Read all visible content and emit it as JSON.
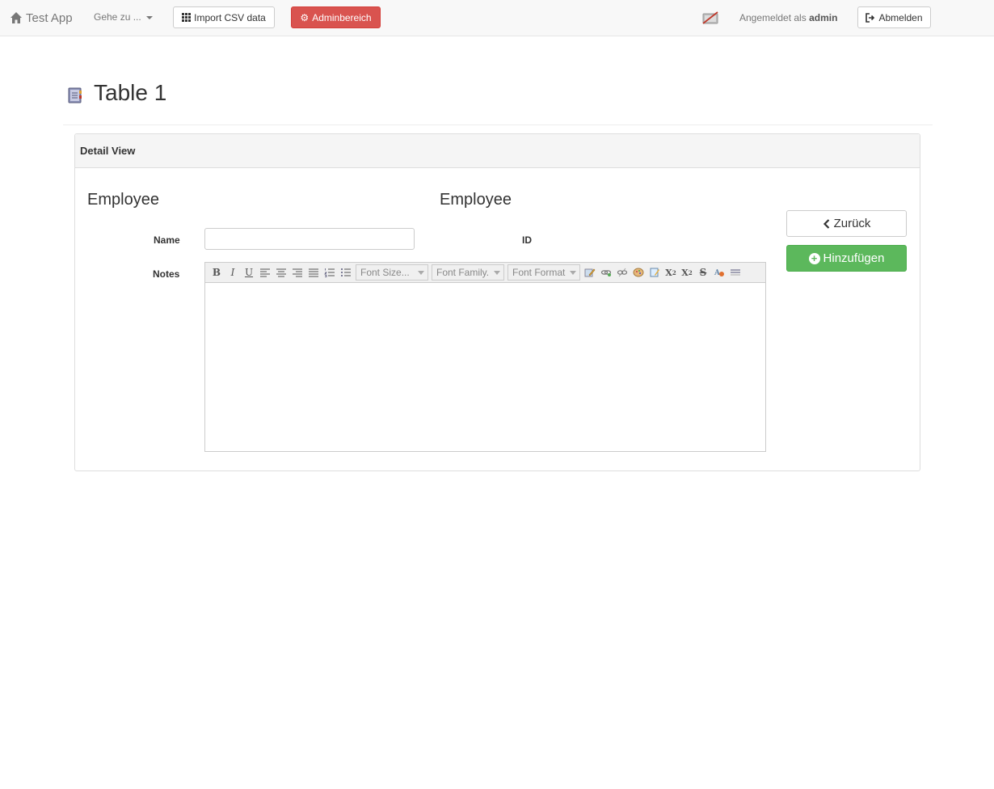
{
  "navbar": {
    "brand": "Test App",
    "goto": "Gehe zu ...",
    "import_csv": "Import CSV data",
    "admin": "Adminbereich",
    "logged_in_prefix": "Angemeldet als",
    "logged_in_user": "admin",
    "logout": "Abmelden"
  },
  "page": {
    "title": "Table 1"
  },
  "panel": {
    "heading": "Detail View",
    "section_left": "Employee",
    "section_right": "Employee",
    "fields": {
      "name_label": "Name",
      "name_value": "",
      "id_label": "ID",
      "notes_label": "Notes"
    },
    "editor": {
      "font_size_placeholder": "Font Size...",
      "font_family_placeholder": "Font Family.",
      "font_format_placeholder": "Font Format"
    }
  },
  "actions": {
    "back": "Zurück",
    "add": "Hinzufügen"
  },
  "colors": {
    "danger": "#d9534f",
    "success": "#5cb85c",
    "navbar_bg": "#f8f8f8"
  }
}
